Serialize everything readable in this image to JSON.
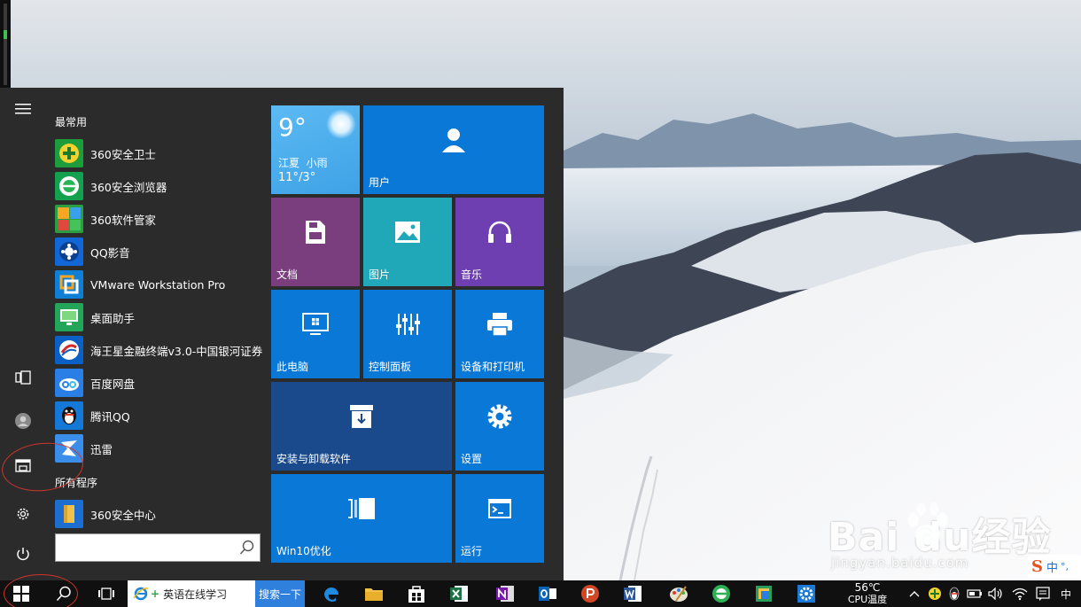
{
  "start_menu": {
    "most_used_header": "最常用",
    "all_programs_header": "所有程序",
    "most_used": [
      {
        "label": "360安全卫士",
        "icon": "360-guard-icon"
      },
      {
        "label": "360安全浏览器",
        "icon": "360-browser-icon"
      },
      {
        "label": "360软件管家",
        "icon": "360-software-manager-icon"
      },
      {
        "label": "QQ影音",
        "icon": "qq-player-icon"
      },
      {
        "label": "VMware Workstation Pro",
        "icon": "vmware-icon"
      },
      {
        "label": "桌面助手",
        "icon": "desktop-assistant-icon"
      },
      {
        "label": "海王星金融终端v3.0-中国银河证券",
        "icon": "neptune-finance-icon"
      },
      {
        "label": "百度网盘",
        "icon": "baidu-netdisk-icon"
      },
      {
        "label": "腾讯QQ",
        "icon": "qq-penguin-icon"
      },
      {
        "label": "迅雷",
        "icon": "xunlei-icon"
      }
    ],
    "all_programs": [
      {
        "label": "360安全中心",
        "icon": "folder-icon"
      }
    ],
    "search_placeholder": ""
  },
  "tiles": {
    "weather": {
      "temp": "9°",
      "location": "江夏  小雨",
      "range": "11°/3°"
    },
    "user": "用户",
    "documents": "文档",
    "pictures": "图片",
    "music": "音乐",
    "this_pc": "此电脑",
    "control_panel": "控制面板",
    "devices_printers": "设备和打印机",
    "install_uninstall": "安装与卸载软件",
    "settings": "设置",
    "win10_optimize": "Win10优化",
    "run": "运行"
  },
  "taskbar": {
    "ie_text": "英语在线学习",
    "search_button": "搜索一下",
    "temp": "56℃",
    "cpu_label": "CPU温度",
    "ime": "中",
    "ime_badge": "中"
  },
  "watermark": {
    "brand": "Bai  du经验",
    "url": "jingyan.baidu.com"
  },
  "colors": {
    "tile_blue": "#0a78d7",
    "tile_purple_doc": "#7a3e7f",
    "tile_teal": "#20a7b8",
    "tile_music": "#6e3fb0",
    "tile_darkblue": "#1a4a8c",
    "weather": "#4fb1ef",
    "menu_bg": "#2b2b2b",
    "annotation_red": "#d0342c"
  }
}
